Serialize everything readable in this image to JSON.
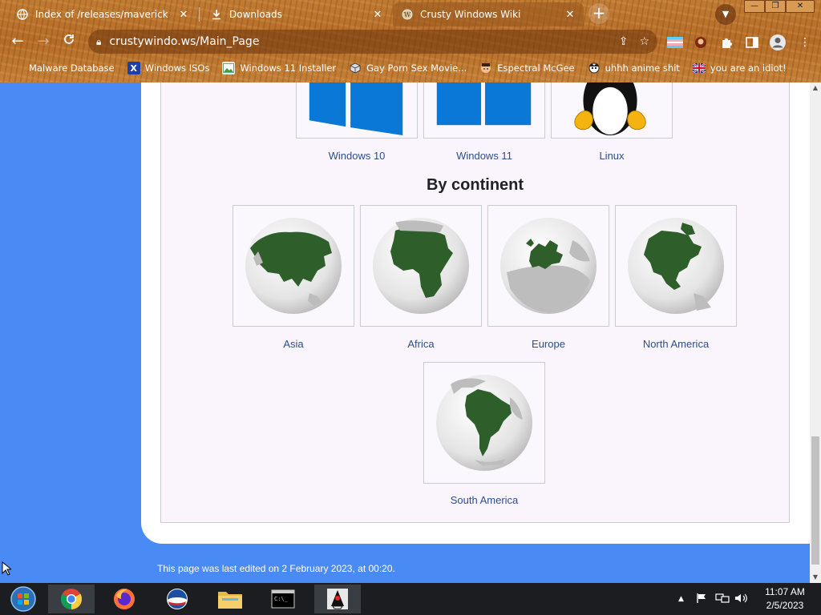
{
  "browser": {
    "tabs": [
      {
        "title": "Index of /releases/maverick",
        "favicon": "globe-icon",
        "active": false
      },
      {
        "title": "Downloads",
        "favicon": "download-icon",
        "active": false
      },
      {
        "title": "Crusty Windows Wiki",
        "favicon": "wiki-icon",
        "active": true
      }
    ],
    "url": "crustywindo.ws/Main_Page",
    "bookmarks": [
      {
        "label": "Malware Database",
        "icon": "blank-icon"
      },
      {
        "label": "Windows ISOs",
        "icon": "x-logo-icon"
      },
      {
        "label": "Windows 11 Installer",
        "icon": "image-icon"
      },
      {
        "label": "Gay Porn Sex Movie...",
        "icon": "cube-icon"
      },
      {
        "label": "Espectral McGee",
        "icon": "face-icon"
      },
      {
        "label": "uhhh anime shit",
        "icon": "anime-icon"
      },
      {
        "label": "you are an idiot!",
        "icon": "flag-icon"
      }
    ]
  },
  "wiki": {
    "os_items": [
      {
        "caption": "Windows 10"
      },
      {
        "caption": "Windows 11"
      },
      {
        "caption": "Linux"
      }
    ],
    "continent_heading": "By continent",
    "continents": [
      {
        "caption": "Asia"
      },
      {
        "caption": "Africa"
      },
      {
        "caption": "Europe"
      },
      {
        "caption": "North America"
      },
      {
        "caption": "South America"
      }
    ],
    "footer": "This page was last edited on 2 February 2023, at 00:20."
  },
  "taskbar": {
    "time": "11:07 AM",
    "date": "2/5/2023"
  },
  "colors": {
    "page_bg": "#4a8af4",
    "link": "#2d4d8c",
    "land": "#2e5e2a",
    "windows_blue": "#0a78d7"
  }
}
